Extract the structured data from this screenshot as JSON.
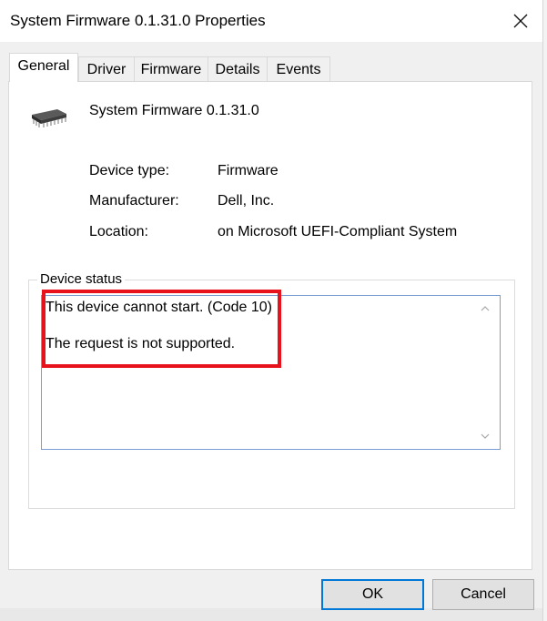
{
  "window": {
    "title": "System Firmware 0.1.31.0 Properties"
  },
  "tabs": [
    {
      "label": "General",
      "active": true
    },
    {
      "label": "Driver",
      "active": false
    },
    {
      "label": "Firmware",
      "active": false
    },
    {
      "label": "Details",
      "active": false
    },
    {
      "label": "Events",
      "active": false
    }
  ],
  "device": {
    "name": "System Firmware 0.1.31.0",
    "icon": "chip-icon",
    "properties": [
      {
        "label": "Device type:",
        "value": "Firmware"
      },
      {
        "label": "Manufacturer:",
        "value": "Dell, Inc."
      },
      {
        "label": "Location:",
        "value": "on Microsoft UEFI-Compliant System"
      }
    ]
  },
  "status": {
    "group_title": "Device status",
    "lines": [
      "This device cannot start. (Code 10)",
      "The request is not supported."
    ]
  },
  "buttons": {
    "ok": "OK",
    "cancel": "Cancel"
  },
  "colors": {
    "highlight": "#e8121c",
    "focus_border": "#0078d7"
  }
}
